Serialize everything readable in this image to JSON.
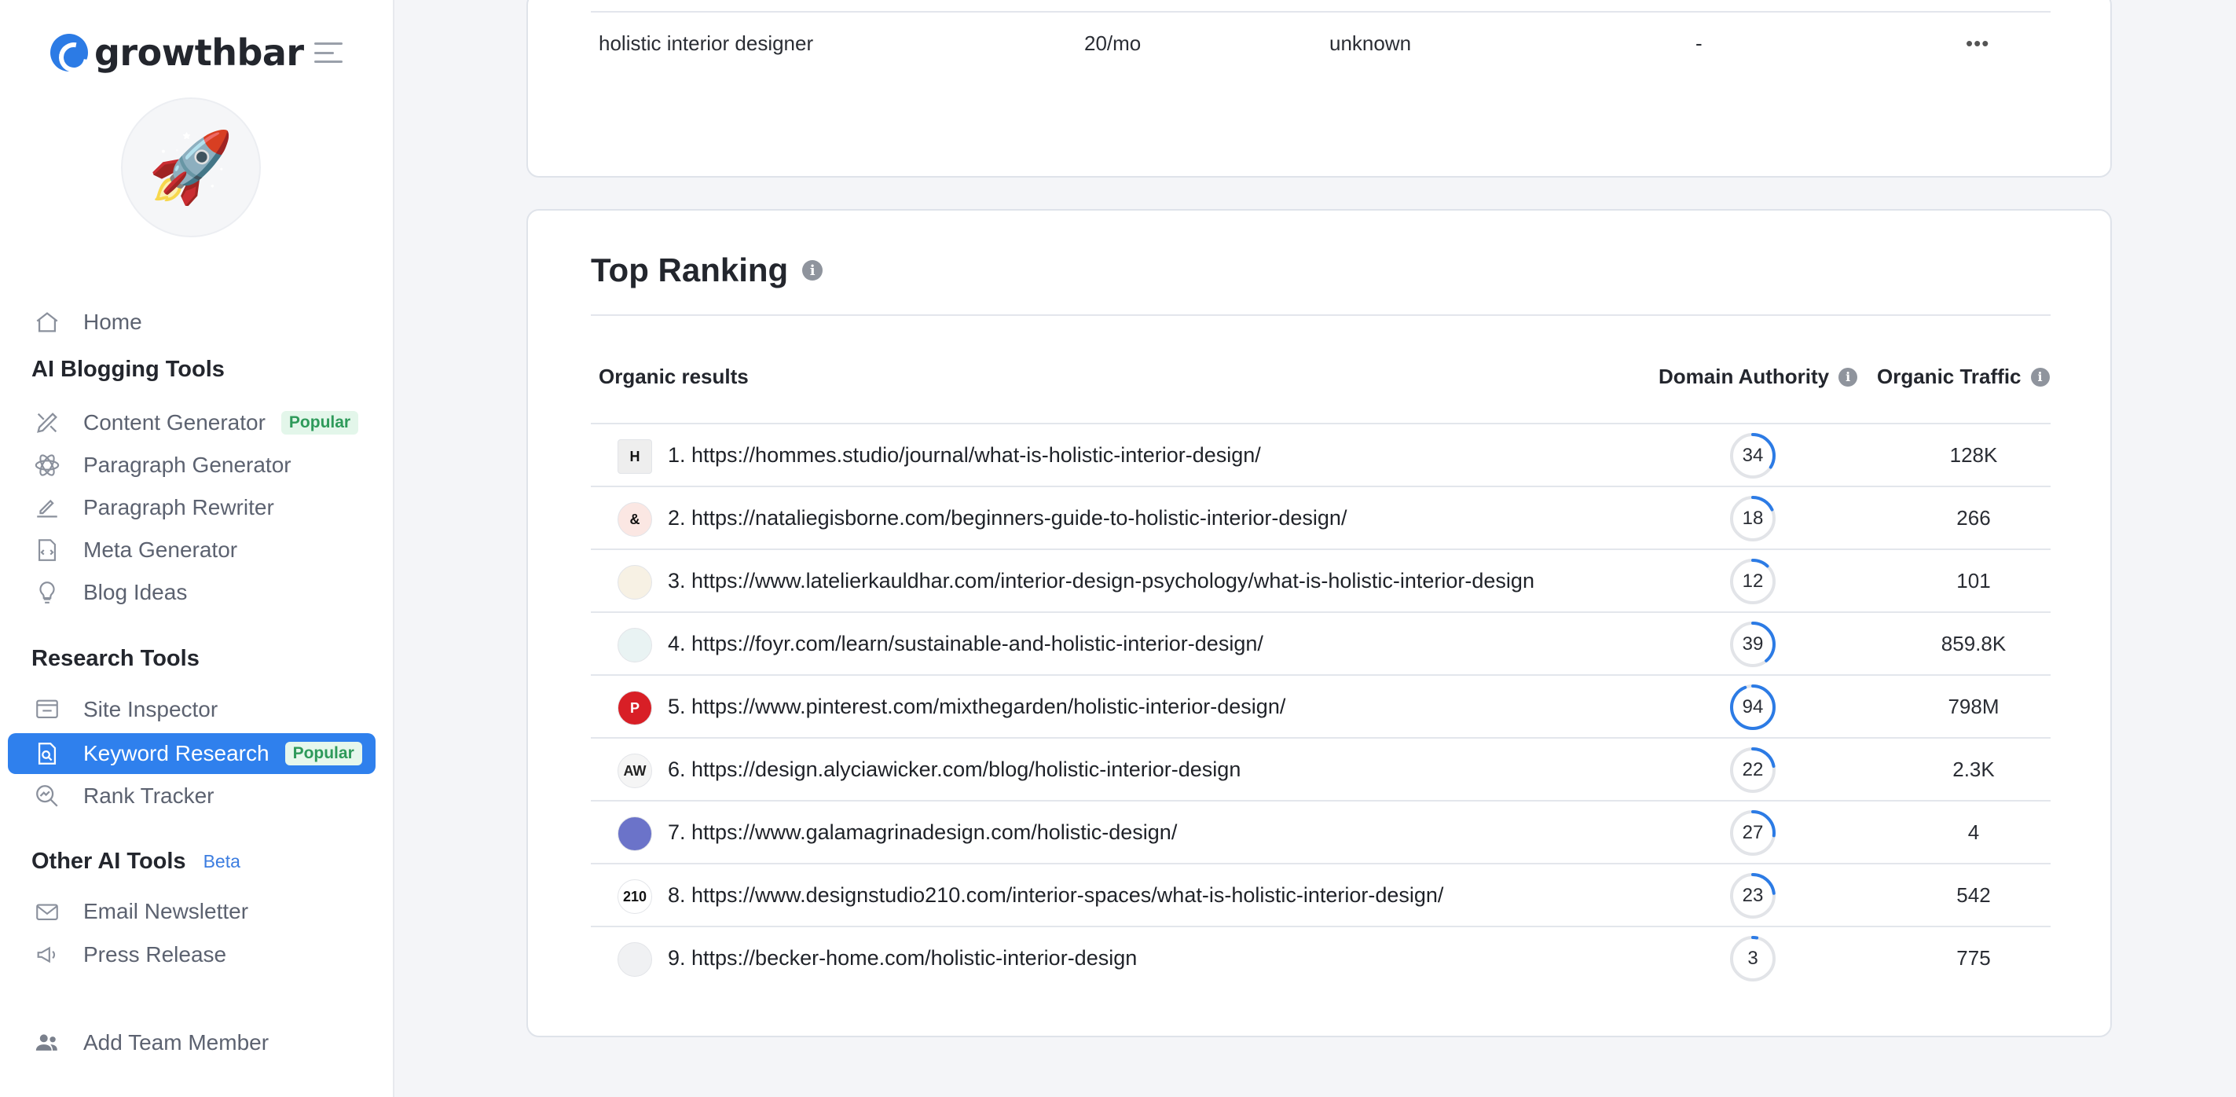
{
  "app": {
    "brand": "growthbar"
  },
  "sidebar": {
    "home": "Home",
    "sections": {
      "ai_blogging": "AI Blogging Tools",
      "research": "Research Tools",
      "other": "Other AI Tools",
      "other_badge": "Beta"
    },
    "blogging_items": [
      {
        "label": "Content Generator",
        "badge": "Popular",
        "icon": "pencil-ruler-icon"
      },
      {
        "label": "Paragraph Generator",
        "badge": "",
        "icon": "atom-icon"
      },
      {
        "label": "Paragraph Rewriter",
        "badge": "",
        "icon": "pen-lines-icon"
      },
      {
        "label": "Meta Generator",
        "badge": "",
        "icon": "code-file-icon"
      },
      {
        "label": "Blog Ideas",
        "badge": "",
        "icon": "lightbulb-icon"
      }
    ],
    "research_items": [
      {
        "label": "Site Inspector",
        "badge": "",
        "icon": "browser-eye-icon"
      },
      {
        "label": "Keyword Research",
        "badge": "Popular",
        "icon": "document-search-icon",
        "active": true
      },
      {
        "label": "Rank Tracker",
        "badge": "",
        "icon": "chart-search-icon"
      }
    ],
    "other_items": [
      {
        "label": "Email Newsletter",
        "icon": "envelope-icon"
      },
      {
        "label": "Press Release",
        "icon": "megaphone-icon"
      }
    ],
    "add_team": "Add Team Member"
  },
  "keyword_row": {
    "keyword": "holistic interior designer",
    "volume": "20/mo",
    "difficulty": "unknown",
    "cpc": "-",
    "more": "•••"
  },
  "top_ranking": {
    "title": "Top Ranking",
    "col_results": "Organic results",
    "col_da": "Domain Authority",
    "col_traffic": "Organic Traffic",
    "rows": [
      {
        "url": "1. https://hommes.studio/journal/what-is-holistic-interior-design/",
        "da": 34,
        "da_text": "34",
        "traffic": "128K",
        "fav": "H"
      },
      {
        "url": "2. https://nataliegisborne.com/beginners-guide-to-holistic-interior-design/",
        "da": 18,
        "da_text": "18",
        "traffic": "266",
        "fav": "&"
      },
      {
        "url": "3. https://www.latelierkauldhar.com/interior-design-psychology/what-is-holistic-interior-design",
        "da": 12,
        "da_text": "12",
        "traffic": "101",
        "fav": ""
      },
      {
        "url": "4. https://foyr.com/learn/sustainable-and-holistic-interior-design/",
        "da": 39,
        "da_text": "39",
        "traffic": "859.8K",
        "fav": ""
      },
      {
        "url": "5. https://www.pinterest.com/mixthegarden/holistic-interior-design/",
        "da": 94,
        "da_text": "94",
        "traffic": "798M",
        "fav": "P"
      },
      {
        "url": "6. https://design.alyciawicker.com/blog/holistic-interior-design",
        "da": 22,
        "da_text": "22",
        "traffic": "2.3K",
        "fav": "AW"
      },
      {
        "url": "7. https://www.galamagrinadesign.com/holistic-design/",
        "da": 27,
        "da_text": "27",
        "traffic": "4",
        "fav": ""
      },
      {
        "url": "8. https://www.designstudio210.com/interior-spaces/what-is-holistic-interior-design/",
        "da": 23,
        "da_text": "23",
        "traffic": "542",
        "fav": "210"
      },
      {
        "url": "9. https://becker-home.com/holistic-interior-design",
        "da": 3,
        "da_text": "3",
        "traffic": "775",
        "fav": ""
      }
    ]
  },
  "colors": {
    "accent": "#2f80ed",
    "ring_track": "#e2e4e8",
    "ring_fill": "#2c7be5",
    "badge_green": "#2e9a5a"
  }
}
